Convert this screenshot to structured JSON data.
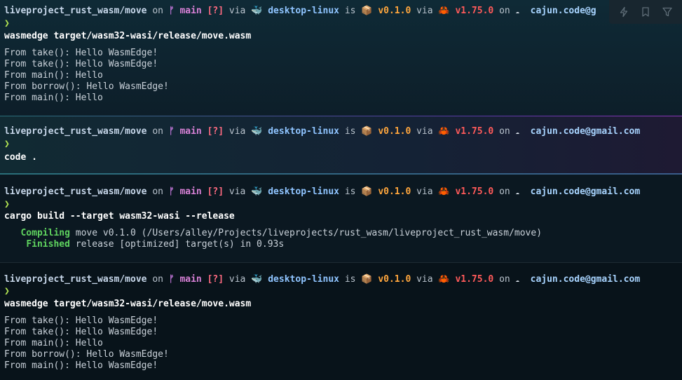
{
  "prompt": {
    "path": "liveproject_rust_wasm/move",
    "on": "on",
    "branch_icon": "ᚠ",
    "branch": "main",
    "status": "[?]",
    "via": "via",
    "whale": "🐳",
    "context": "desktop-linux",
    "is": "is",
    "pkg_icon": "📦",
    "pkg_version": "v0.1.0",
    "crab": "🦀",
    "rust_version": "v1.75.0",
    "aws_icon": "☁",
    "email": "cajun.code@gmail.com",
    "email_truncated": "cajun.code@g",
    "chevron": "❯"
  },
  "blocks": [
    {
      "command": "wasmedge target/wasm32-wasi/release/move.wasm",
      "output": [
        "From take(): Hello WasmEdge!",
        "From take(): Hello WasmEdge!",
        "From main(): Hello",
        "From borrow(): Hello WasmEdge!",
        "From main(): Hello"
      ]
    },
    {
      "command": "code ."
    },
    {
      "command": "cargo build --target wasm32-wasi --release",
      "compile": {
        "compiling_label": "Compiling",
        "compiling_text": "move v0.1.0 (/Users/alley/Projects/liveprojects/rust_wasm/liveproject_rust_wasm/move)",
        "finished_label": "Finished",
        "finished_text": "release [optimized] target(s) in 0.93s"
      }
    },
    {
      "command": "wasmedge target/wasm32-wasi/release/move.wasm",
      "output": [
        "From take(): Hello WasmEdge!",
        "From take(): Hello WasmEdge!",
        "From main(): Hello",
        "From borrow(): Hello WasmEdge!",
        "From main(): Hello WasmEdge!"
      ]
    }
  ],
  "toolbar": {
    "icons": [
      "lightning-icon",
      "bookmark-icon",
      "filter-icon"
    ]
  },
  "colors": {
    "background": "#0b1620",
    "branch": "#d780d6",
    "package_version": "#ffa63d",
    "rust_version": "#ff5a5a",
    "success": "#5fd35f"
  }
}
